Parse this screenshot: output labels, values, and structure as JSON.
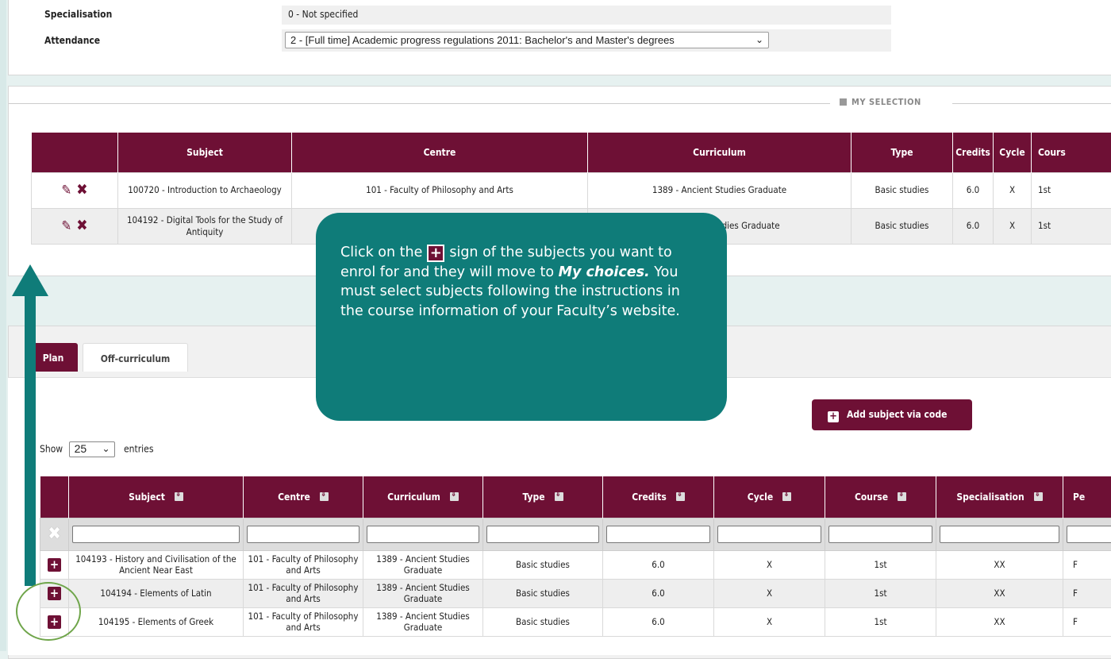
{
  "info": {
    "specialisation_label": "Specialisation",
    "specialisation_value": "0 - Not specified",
    "attendance_label": "Attendance",
    "attendance_value": "2 - [Full time] Academic progress regulations 2011: Bachelor's and Master's degrees"
  },
  "selection": {
    "legend": "MY SELECTION",
    "headers": [
      "",
      "Subject",
      "Centre",
      "Curriculum",
      "Type",
      "Credits",
      "Cycle",
      "Cours"
    ],
    "rows": [
      {
        "subject": "100720 - Introduction to Archaeology",
        "centre": "101 - Faculty of Philosophy and Arts",
        "curriculum": "1389 - Ancient Studies Graduate",
        "type": "Basic studies",
        "credits": "6.0",
        "cycle": "X",
        "course": "1st"
      },
      {
        "subject": "104192 - Digital Tools for the Study of Antiquity",
        "centre": "",
        "curriculum": "tudies Graduate",
        "type": "Basic studies",
        "credits": "6.0",
        "cycle": "X",
        "course": "1st"
      }
    ]
  },
  "tabs": {
    "plan": "Plan",
    "off": "Off-curriculum"
  },
  "add_button": "Add subject via code",
  "show": {
    "prefix": "Show",
    "value": "25",
    "suffix": "entries"
  },
  "plan": {
    "headers": [
      "Subject",
      "Centre",
      "Curriculum",
      "Type",
      "Credits",
      "Cycle",
      "Course",
      "Specialisation",
      "Pe"
    ],
    "rows": [
      {
        "subject": "104193 - History and Civilisation of the Ancient Near East",
        "centre": "101 - Faculty of Philosophy and Arts",
        "curriculum": "1389 - Ancient Studies Graduate",
        "type": "Basic studies",
        "credits": "6.0",
        "cycle": "X",
        "course": "1st",
        "spec": "XX",
        "pe": "F"
      },
      {
        "subject": "104194 - Elements of Latin",
        "centre": "101 - Faculty of Philosophy and Arts",
        "curriculum": "1389 - Ancient Studies Graduate",
        "type": "Basic studies",
        "credits": "6.0",
        "cycle": "X",
        "course": "1st",
        "spec": "XX",
        "pe": "F"
      },
      {
        "subject": "104195 - Elements of Greek",
        "centre": "101 - Faculty of Philosophy and Arts",
        "curriculum": "1389 - Ancient Studies Graduate",
        "type": "Basic studies",
        "credits": "6.0",
        "cycle": "X",
        "course": "1st",
        "spec": "XX",
        "pe": "F"
      }
    ]
  },
  "callout": {
    "line1a": "Click on the",
    "line1b": "sign of the subjects you want to enrol for and they will move to",
    "emph": "My choices.",
    "line2": "You must select subjects following the instructions in the course information of your Faculty’s website."
  },
  "colors": {
    "brand": "#6e1035",
    "callout": "#0f7c79",
    "highlight_circle": "#6fa54a"
  }
}
